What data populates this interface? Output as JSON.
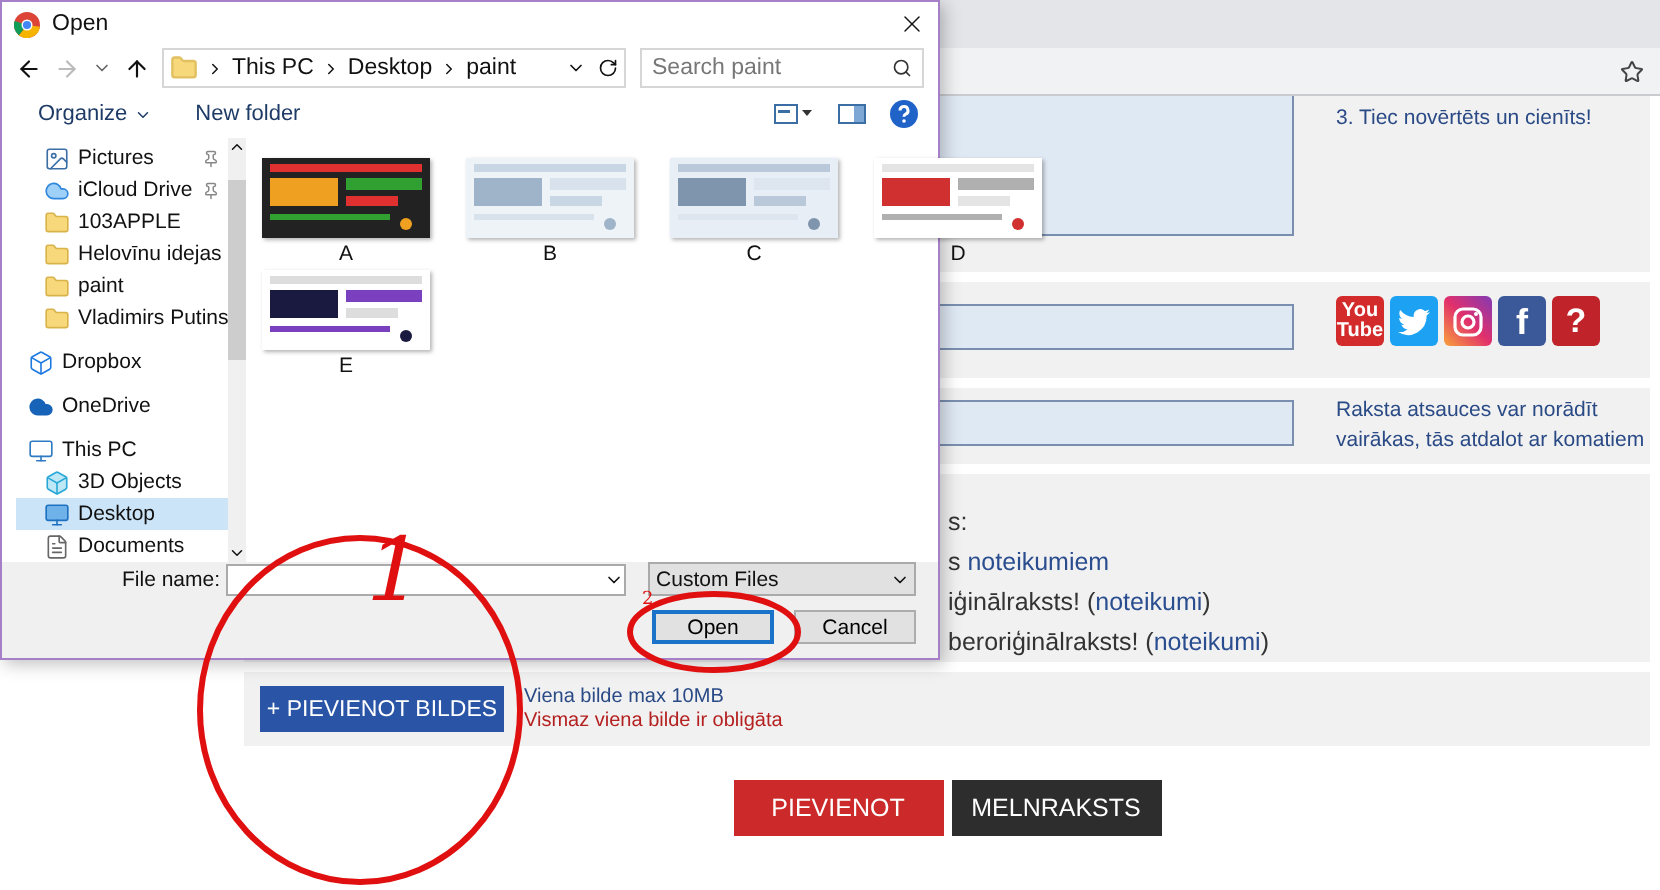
{
  "dialog": {
    "title": "Open",
    "breadcrumb": [
      "This PC",
      "Desktop",
      "paint"
    ],
    "search": {
      "placeholder": "Search paint"
    },
    "toolbar": {
      "organize": "Organize",
      "new_folder": "New folder"
    },
    "quick_access": [
      {
        "label": "Pictures",
        "kind": "pictures",
        "pinned": true,
        "selected": false
      },
      {
        "label": "iCloud Drive",
        "kind": "cloud",
        "pinned": true,
        "selected": false
      },
      {
        "label": "103APPLE",
        "kind": "folder",
        "pinned": false,
        "selected": false
      },
      {
        "label": "Helovīnu idejas",
        "kind": "folder",
        "pinned": false,
        "selected": false
      },
      {
        "label": "paint",
        "kind": "folder",
        "pinned": false,
        "selected": false
      },
      {
        "label": "Vladimirs Putins",
        "kind": "folder",
        "pinned": false,
        "selected": false
      }
    ],
    "nav": [
      {
        "label": "Dropbox",
        "kind": "dropbox",
        "selected": false
      },
      {
        "label": "OneDrive",
        "kind": "onedrive",
        "selected": false
      },
      {
        "label": "This PC",
        "kind": "pc",
        "selected": false,
        "children": [
          {
            "label": "3D Objects",
            "kind": "objects",
            "selected": false
          },
          {
            "label": "Desktop",
            "kind": "desktop",
            "selected": true
          },
          {
            "label": "Documents",
            "kind": "documents",
            "selected": false
          }
        ]
      }
    ],
    "files": [
      {
        "name": "A"
      },
      {
        "name": "B"
      },
      {
        "name": "C"
      },
      {
        "name": "D"
      },
      {
        "name": "E"
      }
    ],
    "file_name_label": "File name:",
    "filter": "Custom Files",
    "buttons": [
      {
        "label": "Open",
        "default": true
      },
      {
        "label": "Cancel",
        "default": false
      }
    ]
  },
  "page": {
    "tips_note": "3. Tiec novērtēts un cienīts!",
    "social": [
      {
        "kind": "youtube",
        "text": [
          "You",
          "Tube"
        ]
      },
      {
        "kind": "twitter"
      },
      {
        "kind": "instagram"
      },
      {
        "kind": "facebook",
        "text": [
          "f"
        ]
      },
      {
        "kind": "help",
        "text": [
          "?"
        ]
      }
    ],
    "links_hint": "Raksta atsauces var norādīt vairākas, tās atdalot ar komatiem",
    "rules": [
      {
        "text": "s:"
      },
      {
        "text": "s ",
        "link": "noteikumiem"
      },
      {
        "text": "iģinālraksts! (",
        "link": "noteikumi",
        "after": ")"
      },
      {
        "text": "beroriģinālraksts! (",
        "link": "noteikumi",
        "after": ")"
      }
    ],
    "upload_button": "+ PIEVIENOT BILDES",
    "upload_hint": "Viena bilde max 10MB",
    "upload_error": "Vismaz viena bilde ir obligāta",
    "actions": [
      {
        "label": "PIEVIENOT",
        "kind": "primary"
      },
      {
        "label": "MELNRAKSTS",
        "kind": "secondary"
      }
    ]
  },
  "annotations": [
    {
      "kind": "large",
      "text": "1"
    },
    {
      "kind": "small",
      "text": "2"
    }
  ]
}
